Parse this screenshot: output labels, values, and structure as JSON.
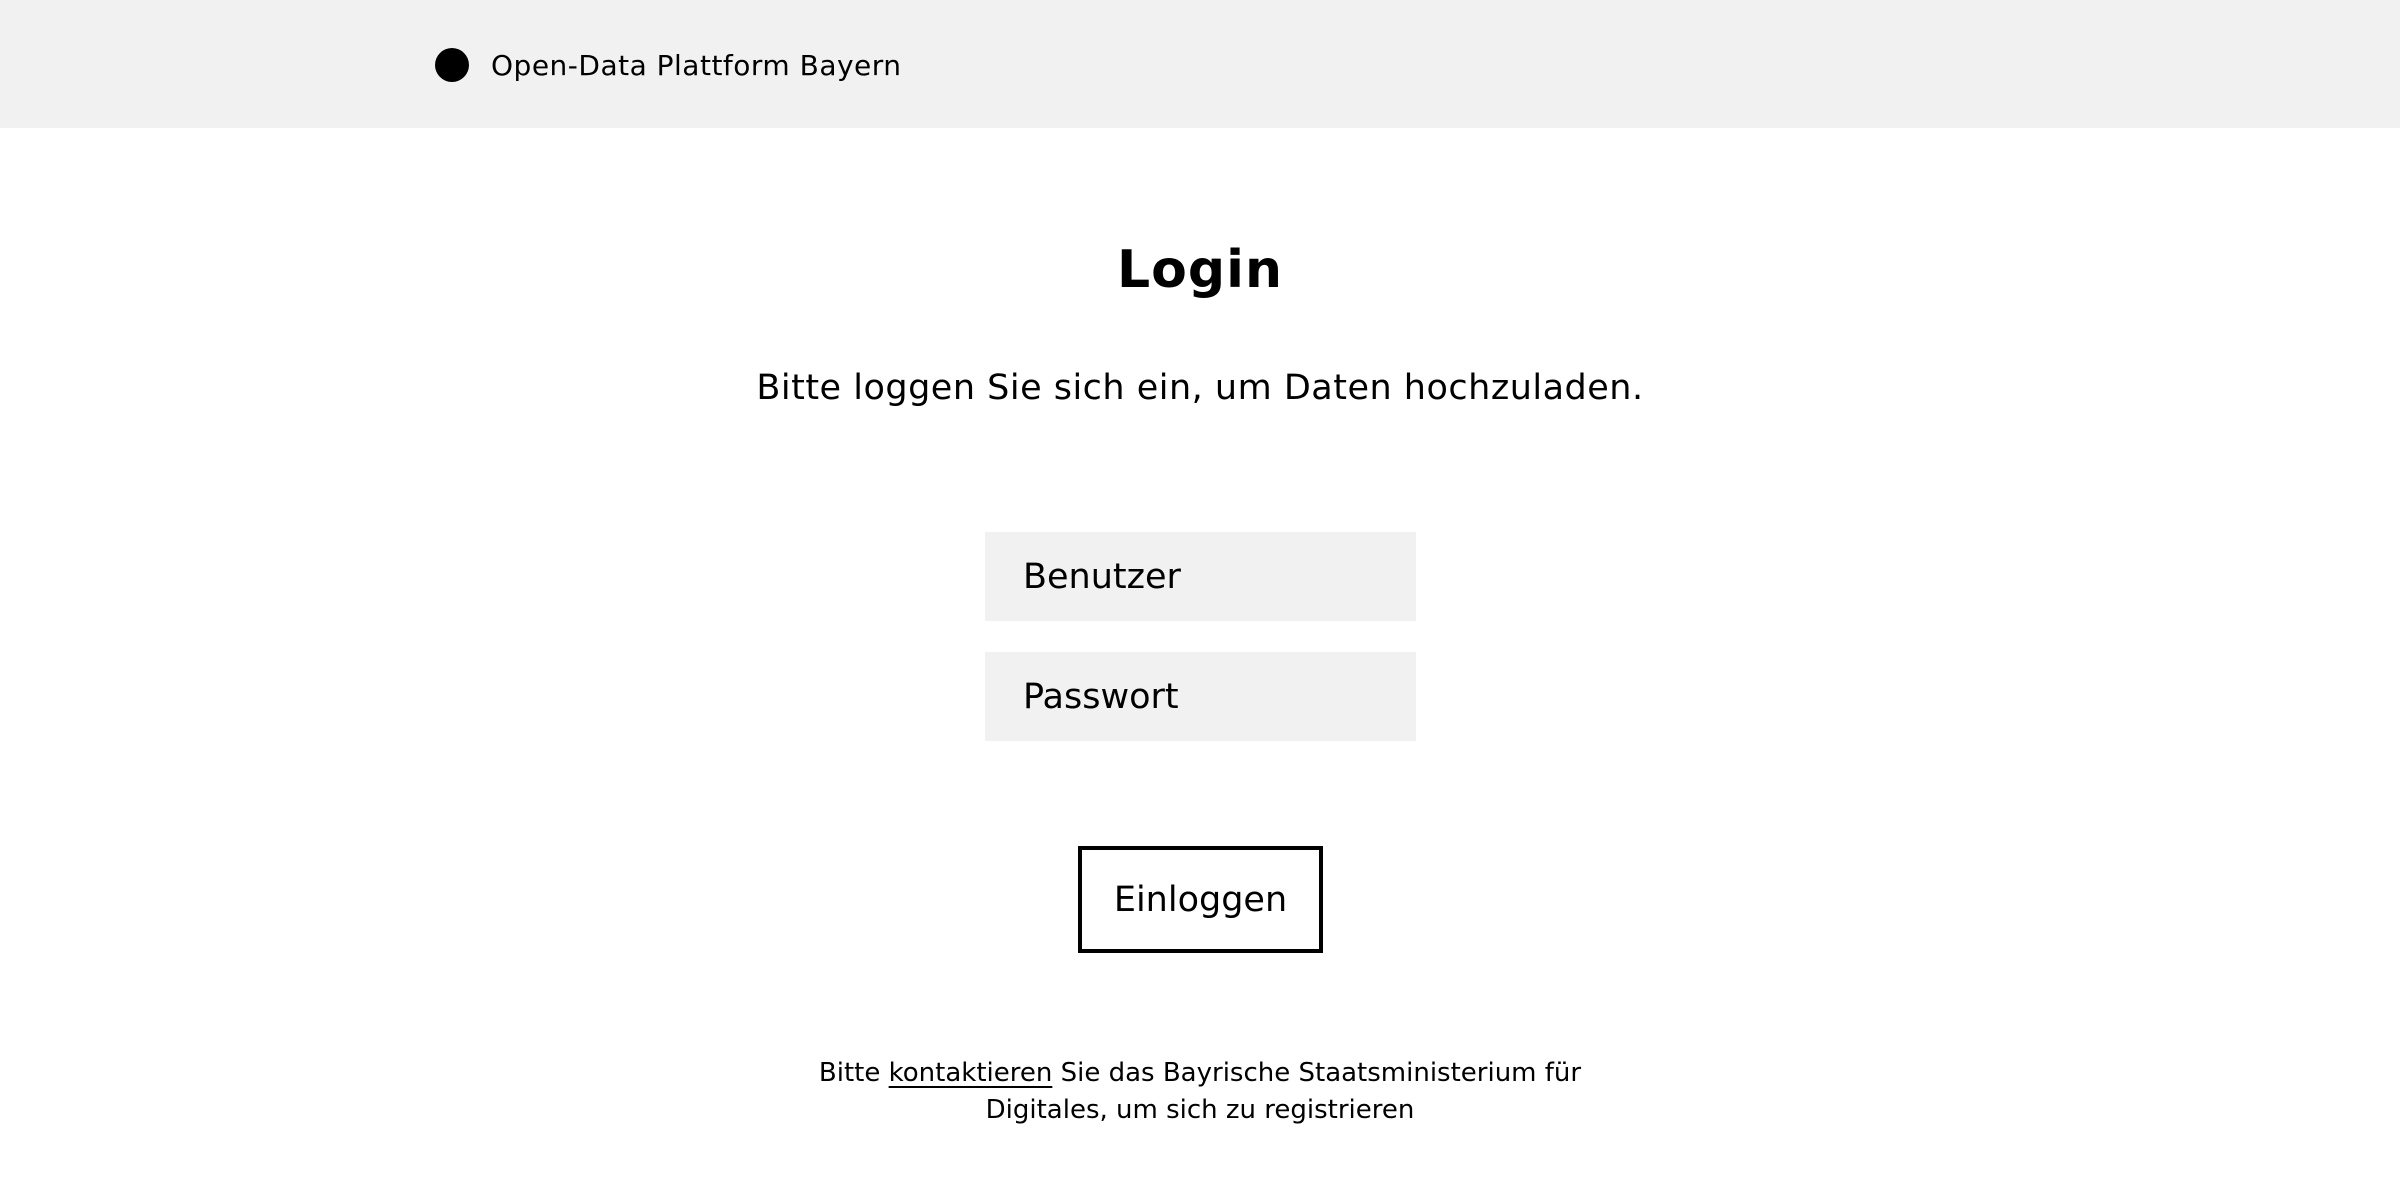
{
  "header": {
    "logo_icon": "filled-circle-icon",
    "site_name": "Open-Data Plattform Bayern",
    "background_color": "#f1f1f1"
  },
  "main": {
    "title": "Login",
    "subtitle": "Bitte loggen Sie sich ein, um Daten hochzuladen.",
    "username_field": {
      "placeholder": "Benutzer",
      "value": ""
    },
    "password_field": {
      "placeholder": "Passwort",
      "value": ""
    },
    "login_button_label": "Einloggen"
  },
  "footer": {
    "text_before_link": "Bitte ",
    "link_text": "kontaktieren",
    "text_after_link": " Sie das Bayrische Staatsministerium für Digitales, um sich zu registrieren"
  }
}
